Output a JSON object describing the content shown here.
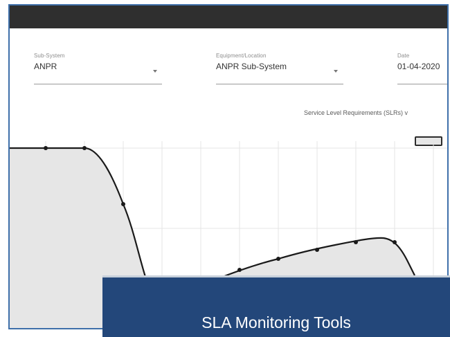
{
  "filters": {
    "subsystem": {
      "label": "Sub-System",
      "value": "ANPR"
    },
    "equipment": {
      "label": "Equipment/Location",
      "value": "ANPR Sub-System"
    },
    "date": {
      "label": "Date",
      "value": "01-04-2020"
    }
  },
  "chart": {
    "title": "Service Level Requirements (SLRs) v",
    "fill_color": "#e6e6e6",
    "line_color": "#1a1a1a"
  },
  "banner": {
    "text": "SLA Monitoring Tools",
    "color": "#23477a"
  }
}
